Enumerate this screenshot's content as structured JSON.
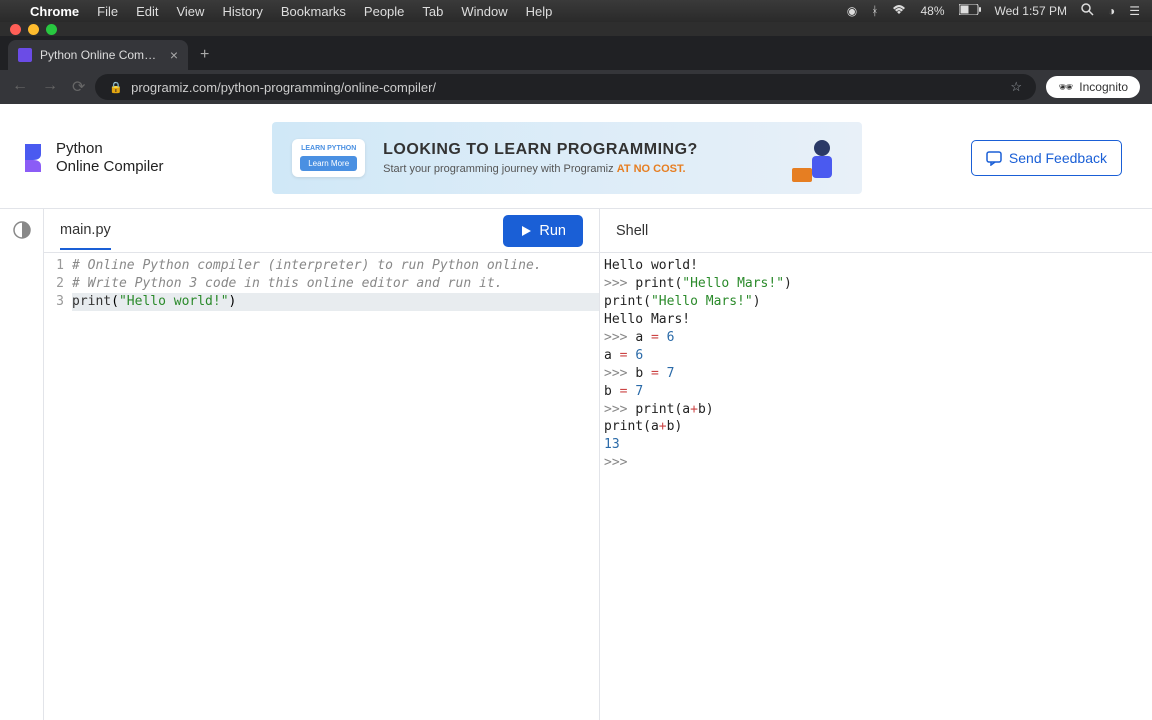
{
  "menubar": {
    "app": "Chrome",
    "items": [
      "File",
      "Edit",
      "View",
      "History",
      "Bookmarks",
      "People",
      "Tab",
      "Window",
      "Help"
    ],
    "battery": "48%",
    "datetime": "Wed 1:57 PM"
  },
  "browser": {
    "tab_title": "Python Online Compiler (Interp",
    "url": "programiz.com/python-programming/online-compiler/",
    "incognito": "Incognito"
  },
  "header": {
    "logo_line1": "Python",
    "logo_line2": "Online Compiler",
    "promo_badge_top": "LEARN PYTHON",
    "promo_badge_btn": "Learn More",
    "promo_headline": "LOOKING TO LEARN PROGRAMMING?",
    "promo_sub_pre": "Start your programming journey with Programiz ",
    "promo_sub_accent": "AT NO COST.",
    "feedback": "Send Feedback"
  },
  "editor": {
    "filename": "main.py",
    "run_label": "Run",
    "lines": [
      {
        "n": "1",
        "type": "comment",
        "text": "# Online Python compiler (interpreter) to run Python online."
      },
      {
        "n": "2",
        "type": "comment",
        "text": "# Write Python 3 code in this online editor and run it."
      },
      {
        "n": "3",
        "type": "print",
        "func": "print",
        "str": "\"Hello world!\"",
        "hl": true
      }
    ]
  },
  "shell": {
    "title": "Shell",
    "lines": [
      {
        "type": "out",
        "text": "Hello world!"
      },
      {
        "type": "in",
        "prompt": ">>> ",
        "func": "print",
        "str": "\"Hello Mars!\""
      },
      {
        "type": "echo",
        "func": "print",
        "str": "\"Hello Mars!\""
      },
      {
        "type": "out",
        "text": "Hello Mars!"
      },
      {
        "type": "in",
        "prompt": ">>> ",
        "assign": "a",
        "op": "=",
        "val": "6"
      },
      {
        "type": "echo_assign",
        "assign": "a",
        "op": "=",
        "val": "6"
      },
      {
        "type": "in",
        "prompt": ">>> ",
        "assign": "b",
        "op": "=",
        "val": "7"
      },
      {
        "type": "echo_assign",
        "assign": "b",
        "op": "=",
        "val": "7"
      },
      {
        "type": "in",
        "prompt": ">>> ",
        "func": "print",
        "expr_l": "a",
        "expr_op": "+",
        "expr_r": "b"
      },
      {
        "type": "echo_expr",
        "func": "print",
        "expr_l": "a",
        "expr_op": "+",
        "expr_r": "b"
      },
      {
        "type": "out_num",
        "text": "13"
      },
      {
        "type": "prompt_only",
        "prompt": ">>> "
      }
    ]
  }
}
